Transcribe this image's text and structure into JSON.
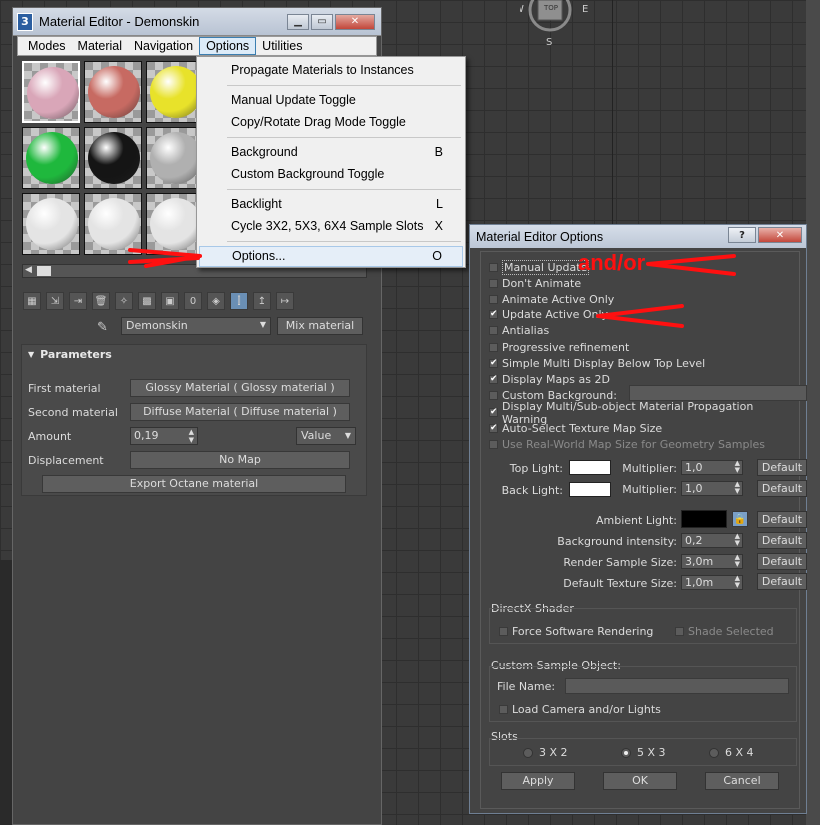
{
  "material_editor": {
    "title": "Material Editor - Demonskin",
    "app_icon": "3",
    "menus": [
      "Modes",
      "Material",
      "Navigation",
      "Options",
      "Utilities"
    ],
    "active_menu": "Options",
    "slot_colors": [
      "#d9a6b8",
      "#c76a62",
      "#e8e22a",
      "#1fb83d",
      "#151515",
      "#b0b0b0",
      "#e4e4e4",
      "#e4e4e4",
      "#e4e4e4"
    ],
    "material_name": "Demonskin",
    "material_type": "Mix material",
    "params": {
      "header": "Parameters",
      "first_label": "First material",
      "first_value": "Glossy Material  ( Glossy material )",
      "second_label": "Second material",
      "second_value": "Diffuse Material  ( Diffuse material )",
      "amount_label": "Amount",
      "amount_value": "0,19",
      "amount_mode": "Value",
      "displacement_label": "Displacement",
      "displacement_value": "No Map",
      "export_label": "Export Octane material"
    }
  },
  "options_menu": {
    "items": [
      {
        "label": "Propagate Materials to Instances",
        "shortcut": ""
      },
      {
        "label": "Manual Update Toggle",
        "shortcut": ""
      },
      {
        "label": "Copy/Rotate Drag Mode Toggle",
        "shortcut": ""
      },
      {
        "label": "Background",
        "shortcut": "B"
      },
      {
        "label": "Custom Background Toggle",
        "shortcut": ""
      },
      {
        "label": "Backlight",
        "shortcut": "L"
      },
      {
        "label": "Cycle 3X2, 5X3, 6X4 Sample Slots",
        "shortcut": "X"
      },
      {
        "label": "Options...",
        "shortcut": "O"
      }
    ]
  },
  "dialog": {
    "title": "Material Editor Options",
    "help": "?",
    "checkboxes": [
      {
        "label": "Manual Update",
        "checked": false
      },
      {
        "label": "Don't Animate",
        "checked": false
      },
      {
        "label": "Animate Active Only",
        "checked": false
      },
      {
        "label": "Update Active Only",
        "checked": true
      },
      {
        "label": "Antialias",
        "checked": false
      },
      {
        "label": "Progressive refinement",
        "checked": false
      },
      {
        "label": "Simple Multi Display Below Top Level",
        "checked": true
      },
      {
        "label": "Display Maps as 2D",
        "checked": true
      },
      {
        "label": "Custom Background:",
        "checked": false
      },
      {
        "label": "Display Multi/Sub-object Material Propagation Warning",
        "checked": true
      },
      {
        "label": "Auto-Select Texture Map Size",
        "checked": true
      },
      {
        "label": "Use Real-World Map Size for Geometry Samples",
        "checked": false
      }
    ],
    "top_light_label": "Top Light:",
    "back_light_label": "Back Light:",
    "multiplier_label": "Multiplier:",
    "top_multiplier": "1,0",
    "back_multiplier": "1,0",
    "ambient_label": "Ambient Light:",
    "bg_intensity_label": "Background intensity:",
    "bg_intensity": "0,2",
    "render_size_label": "Render Sample Size:",
    "render_size": "3,0m",
    "texture_size_label": "Default Texture Size:",
    "texture_size": "1,0m",
    "default_label": "Default",
    "directx_title": "DirectX Shader",
    "force_software": "Force Software Rendering",
    "shade_selected": "Shade Selected",
    "custom_sample_title": "Custom Sample Object:",
    "file_name_label": "File Name:",
    "load_camera": "Load Camera and/or Lights",
    "slots_title": "Slots",
    "slot_options": [
      "3 X 2",
      "5 X 3",
      "6 X 4"
    ],
    "slot_selected": "5 X 3",
    "apply": "Apply",
    "ok": "OK",
    "cancel": "Cancel"
  },
  "annotation_text": "and/or",
  "compass": {
    "w": "W",
    "e": "E",
    "top": "TOP",
    "s": "S"
  },
  "colors": {
    "annotation": "#ff1010",
    "highlight": "#3c7fb1"
  }
}
